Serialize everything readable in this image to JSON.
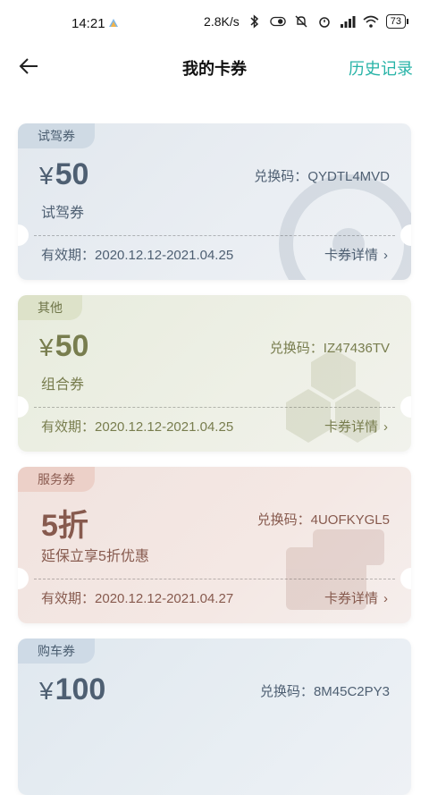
{
  "status": {
    "time": "14:21",
    "speed": "2.8K/s",
    "battery": "73"
  },
  "header": {
    "title": "我的卡券",
    "history": "历史记录"
  },
  "cards": [
    {
      "tag": "试驾券",
      "currency": "¥",
      "amount": "50",
      "subtitle": "试驾券",
      "code_label": "兑换码：",
      "code": "QYDTL4MVD",
      "validity_label": "有效期：",
      "validity": "2020.12.12-2021.04.25",
      "detail": "卡券详情",
      "theme_color": "#5a6d80"
    },
    {
      "tag": "其他",
      "currency": "¥",
      "amount": "50",
      "subtitle": "组合券",
      "code_label": "兑换码：",
      "code": "IZ47436TV",
      "validity_label": "有效期：",
      "validity": "2020.12.12-2021.04.25",
      "detail": "卡券详情",
      "theme_color": "#7a7f55"
    },
    {
      "tag": "服务券",
      "currency": "",
      "amount": "5折",
      "subtitle": "延保立享5折优惠",
      "code_label": "兑换码：",
      "code": "4UOFKYGL5",
      "validity_label": "有效期：",
      "validity": "2020.12.12-2021.04.27",
      "detail": "卡券详情",
      "theme_color": "#8a5a4f"
    },
    {
      "tag": "购车券",
      "currency": "¥",
      "amount": "100",
      "subtitle": "",
      "code_label": "兑换码：",
      "code": "8M45C2PY3",
      "theme_color": "#4e6275"
    }
  ],
  "colors": {
    "accent": "#27b3a7"
  }
}
